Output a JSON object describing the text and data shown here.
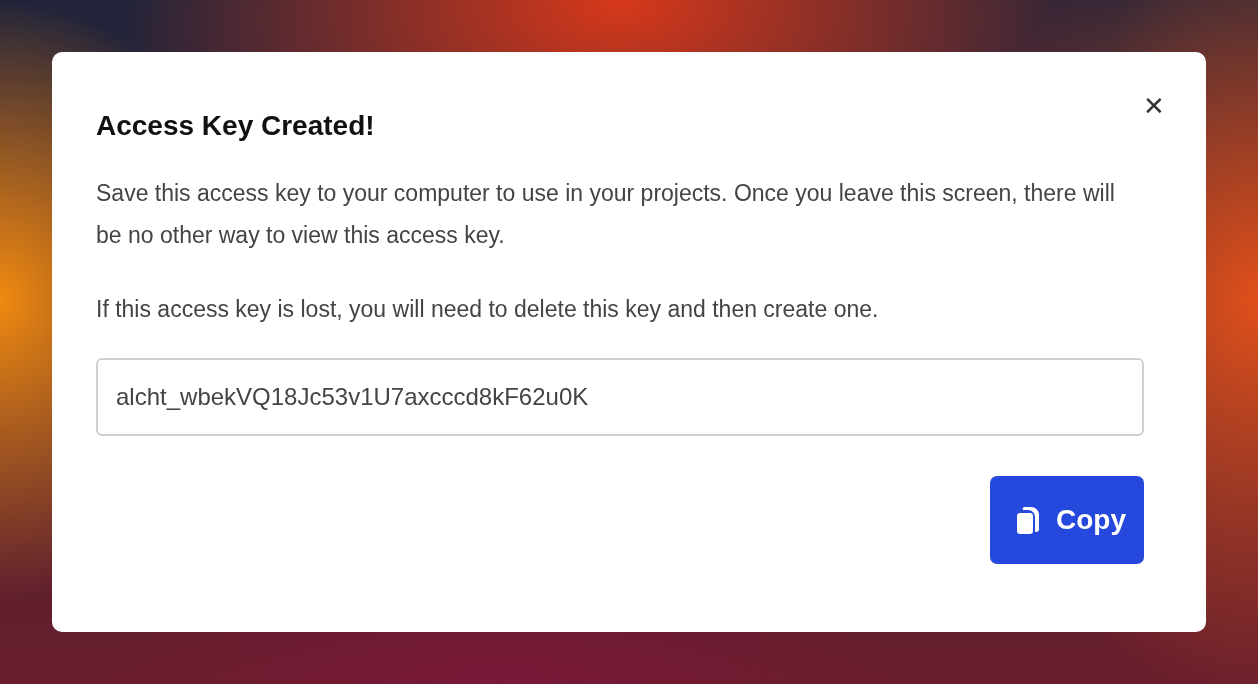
{
  "dialog": {
    "title": "Access Key Created!",
    "close_label": "✕",
    "paragraphs": [
      "Save this access key to your computer to use in your projects. Once you leave this screen, there will be no other way to view this access key.",
      "If this access key is lost, you will need to delete this key and then create one."
    ],
    "key_field": {
      "value": "alcht_wbekVQ18Jc53v1U7axcccd8kF62u0K"
    },
    "copy_button": {
      "label": "Copy"
    }
  }
}
